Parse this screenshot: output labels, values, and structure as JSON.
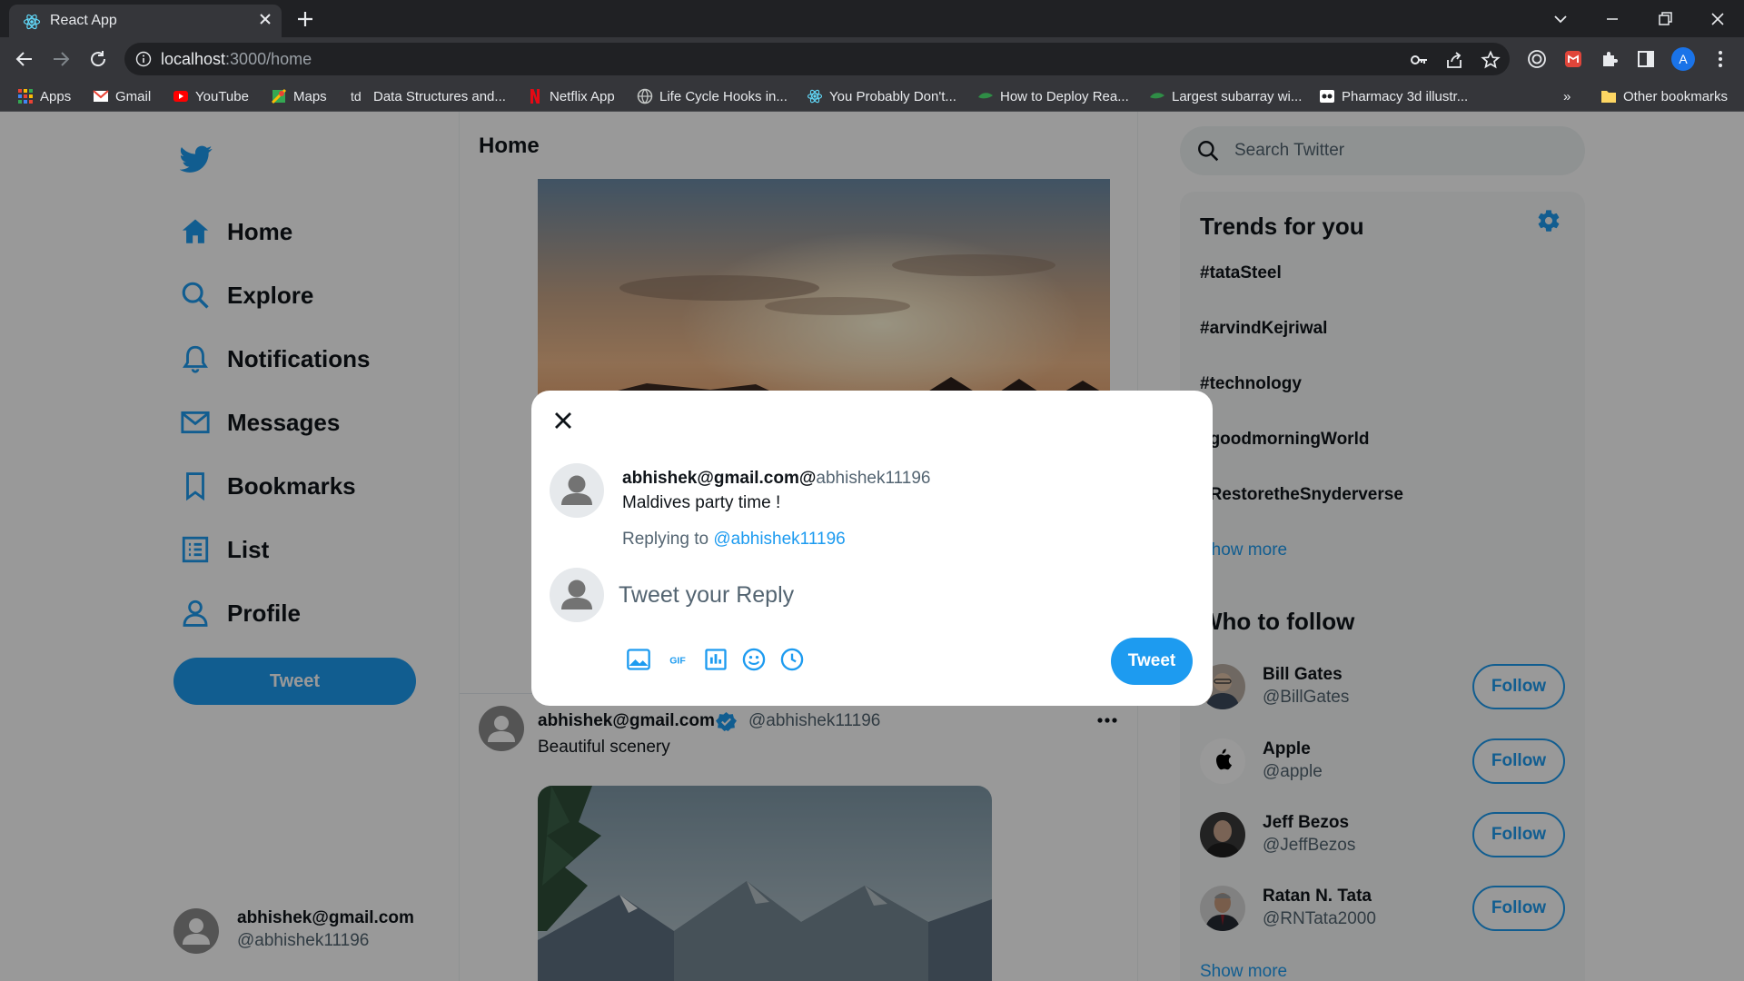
{
  "browser": {
    "tab_title": "React App",
    "url_host": "localhost",
    "url_path": ":3000/home",
    "profile_initial": "A",
    "bookmarks": [
      {
        "label": "Apps",
        "icon": "apps-grid-icon"
      },
      {
        "label": "Gmail",
        "icon": "gmail-icon"
      },
      {
        "label": "YouTube",
        "icon": "youtube-icon"
      },
      {
        "label": "Maps",
        "icon": "maps-icon"
      },
      {
        "label": "Data Structures and...",
        "icon": "td-icon"
      },
      {
        "label": "Netflix App",
        "icon": "netflix-icon"
      },
      {
        "label": "Life Cycle Hooks in...",
        "icon": "globe-icon"
      },
      {
        "label": "You Probably Don't...",
        "icon": "react-icon"
      },
      {
        "label": "How to Deploy Rea...",
        "icon": "leaf-icon"
      },
      {
        "label": "Largest subarray wi...",
        "icon": "leaf-icon"
      },
      {
        "label": "Pharmacy 3d illustr...",
        "icon": "pharmacy-icon"
      }
    ],
    "other_bookmarks": "Other bookmarks",
    "overflow": "»"
  },
  "sidebar": {
    "nav": [
      {
        "label": "Home",
        "icon": "home-icon"
      },
      {
        "label": "Explore",
        "icon": "search-icon"
      },
      {
        "label": "Notifications",
        "icon": "bell-icon"
      },
      {
        "label": "Messages",
        "icon": "mail-icon"
      },
      {
        "label": "Bookmarks",
        "icon": "bookmark-icon"
      },
      {
        "label": "List",
        "icon": "list-icon"
      },
      {
        "label": "Profile",
        "icon": "person-icon"
      }
    ],
    "tweet_button": "Tweet",
    "user": {
      "name": "abhishek@gmail.com",
      "handle": "@abhishek11196"
    }
  },
  "feed": {
    "title": "Home",
    "post": {
      "name": "abhishek@gmail.com",
      "handle": "@abhishek11196",
      "text": "Beautiful scenery"
    }
  },
  "right": {
    "search_placeholder": "Search Twitter",
    "trends_title": "Trends for you",
    "trends": [
      "#tataSteel",
      "#arvindKejriwal",
      "#technology",
      "#goodmorningWorld",
      "#RestoretheSnyderverse"
    ],
    "trends_show_more": "Show more",
    "follow_title": "Who to follow",
    "follow": [
      {
        "name": "Bill Gates",
        "handle": "@BillGates",
        "button": "Follow"
      },
      {
        "name": "Apple",
        "handle": "@apple",
        "button": "Follow"
      },
      {
        "name": "Jeff Bezos",
        "handle": "@JeffBezos",
        "button": "Follow"
      },
      {
        "name": "Ratan N. Tata",
        "handle": "@RNTata2000",
        "button": "Follow"
      }
    ],
    "follow_show_more": "Show more"
  },
  "modal": {
    "author_email": "abhishek@gmail.com@",
    "author_handle": "abhishek11196",
    "text": "Maldives party time !",
    "replying_to_label": "Replying to ",
    "replying_to_handle": "@abhishek11196",
    "reply_placeholder": "Tweet your Reply",
    "tools": [
      "image-icon",
      "gif-icon",
      "poll-icon",
      "emoji-icon",
      "schedule-icon"
    ],
    "tweet_button": "Tweet"
  },
  "colors": {
    "accent": "#1d9bf0",
    "text": "#0f1419",
    "muted": "#536471",
    "chrome_dark": "#202124",
    "chrome_mid": "#35363a"
  }
}
